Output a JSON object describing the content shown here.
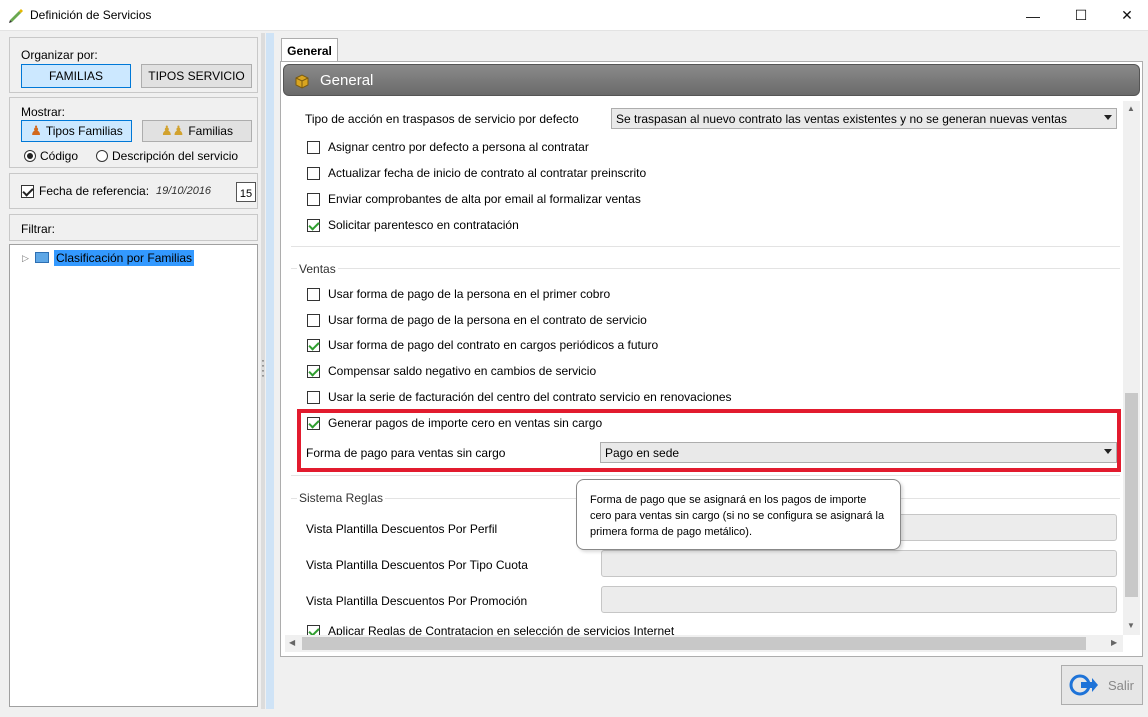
{
  "window": {
    "title": "Definición de Servicios",
    "controls": {
      "minimize": "—",
      "maximize": "☐",
      "close": "✕"
    }
  },
  "left": {
    "organize": {
      "label": "Organizar por:",
      "btn_familias": "FAMILIAS",
      "btn_tipos": "TIPOS SERVICIO"
    },
    "show": {
      "label": "Mostrar:",
      "btn_tipos_familias": "Tipos Familias",
      "btn_familias": "Familias",
      "radio_codigo": "Código",
      "radio_descripcion": "Descripción del servicio"
    },
    "reference": {
      "label": "Fecha de referencia:",
      "date": "19/10/2016",
      "calendar_day": "15"
    },
    "filter_label": "Filtrar:",
    "tree": {
      "root_label": "Clasificación por Familias"
    }
  },
  "right": {
    "tab_label": "General",
    "group_title": "General",
    "traspasos": {
      "label": "Tipo de acción en traspasos de servicio por defecto",
      "value": "Se traspasan al nuevo contrato las ventas existentes y no se generan nuevas ventas"
    },
    "checks_top": [
      {
        "label": "Asignar centro por defecto a persona al contratar",
        "checked": false
      },
      {
        "label": "Actualizar fecha de inicio de contrato al contratar preinscrito",
        "checked": false
      },
      {
        "label": "Enviar comprobantes de alta por email al formalizar ventas",
        "checked": false
      },
      {
        "label": "Solicitar parentesco en contratación",
        "checked": true
      }
    ],
    "ventas": {
      "section_label": "Ventas",
      "checks": [
        {
          "label": "Usar forma de pago de la persona en el primer cobro",
          "checked": false
        },
        {
          "label": "Usar forma de pago de la persona en el contrato de servicio",
          "checked": false
        },
        {
          "label": "Usar forma de pago del contrato en cargos periódicos a futuro",
          "checked": true
        },
        {
          "label": "Compensar saldo negativo en cambios de servicio",
          "checked": true
        },
        {
          "label": "Usar la serie de facturación del centro del contrato servicio en renovaciones",
          "checked": false
        },
        {
          "label": "Generar pagos de importe cero en ventas sin cargo",
          "checked": true
        }
      ],
      "forma_pago_label": "Forma de pago para ventas sin cargo",
      "forma_pago_value": "Pago en sede"
    },
    "sistema": {
      "section_label": "Sistema Reglas",
      "fields": [
        {
          "label": "Vista Plantilla Descuentos Por Perfil"
        },
        {
          "label": "Vista Plantilla Descuentos Por Tipo Cuota"
        },
        {
          "label": "Vista Plantilla Descuentos Por Promoción"
        }
      ],
      "last_check": "Aplicar Reglas de Contratacion en selección de servicios Internet"
    },
    "tooltip": "Forma de pago que se asignará en los pagos de importe cero para ventas sin cargo (si no se configura se asignará la primera forma de pago metálico).",
    "exit_label": "Salir"
  },
  "colors": {
    "highlight": "#e21b2e",
    "selection": "#3399ff",
    "header": "#7a7a7a"
  }
}
